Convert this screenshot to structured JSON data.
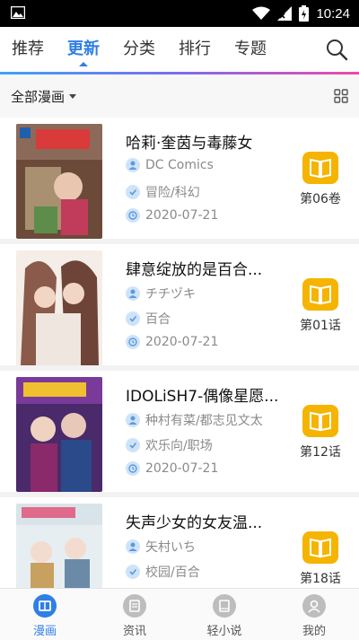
{
  "status_bar": {
    "time": "10:24"
  },
  "tabs": [
    {
      "label": "推荐",
      "active": false
    },
    {
      "label": "更新",
      "active": true
    },
    {
      "label": "分类",
      "active": false
    },
    {
      "label": "排行",
      "active": false
    },
    {
      "label": "专题",
      "active": false
    }
  ],
  "filter": {
    "label": "全部漫画"
  },
  "items": [
    {
      "title": "哈莉·奎茵与毒藤女",
      "author": "DC Comics",
      "genre": "冒险/科幻",
      "date": "2020-07-21",
      "chapter": "第06卷"
    },
    {
      "title": "肆意绽放的是百合...",
      "author": "チチヅキ",
      "genre": "百合",
      "date": "2020-07-21",
      "chapter": "第01话"
    },
    {
      "title": "IDOLiSH7-偶像星愿...",
      "author": "种村有菜/都志见文太",
      "genre": "欢乐向/职场",
      "date": "2020-07-21",
      "chapter": "第12话"
    },
    {
      "title": "失声少女的女友温...",
      "author": "矢村いち",
      "genre": "校园/百合",
      "date": "",
      "chapter": "第18话"
    }
  ],
  "bottom_nav": [
    {
      "label": "漫画",
      "active": true,
      "icon": "comic-icon"
    },
    {
      "label": "资讯",
      "active": false,
      "icon": "news-icon"
    },
    {
      "label": "轻小说",
      "active": false,
      "icon": "novel-icon"
    },
    {
      "label": "我的",
      "active": false,
      "icon": "profile-icon"
    }
  ],
  "colors": {
    "accent": "#2f7fe5",
    "read_button": "#f5b400",
    "meta_text": "#8a8a8a"
  }
}
